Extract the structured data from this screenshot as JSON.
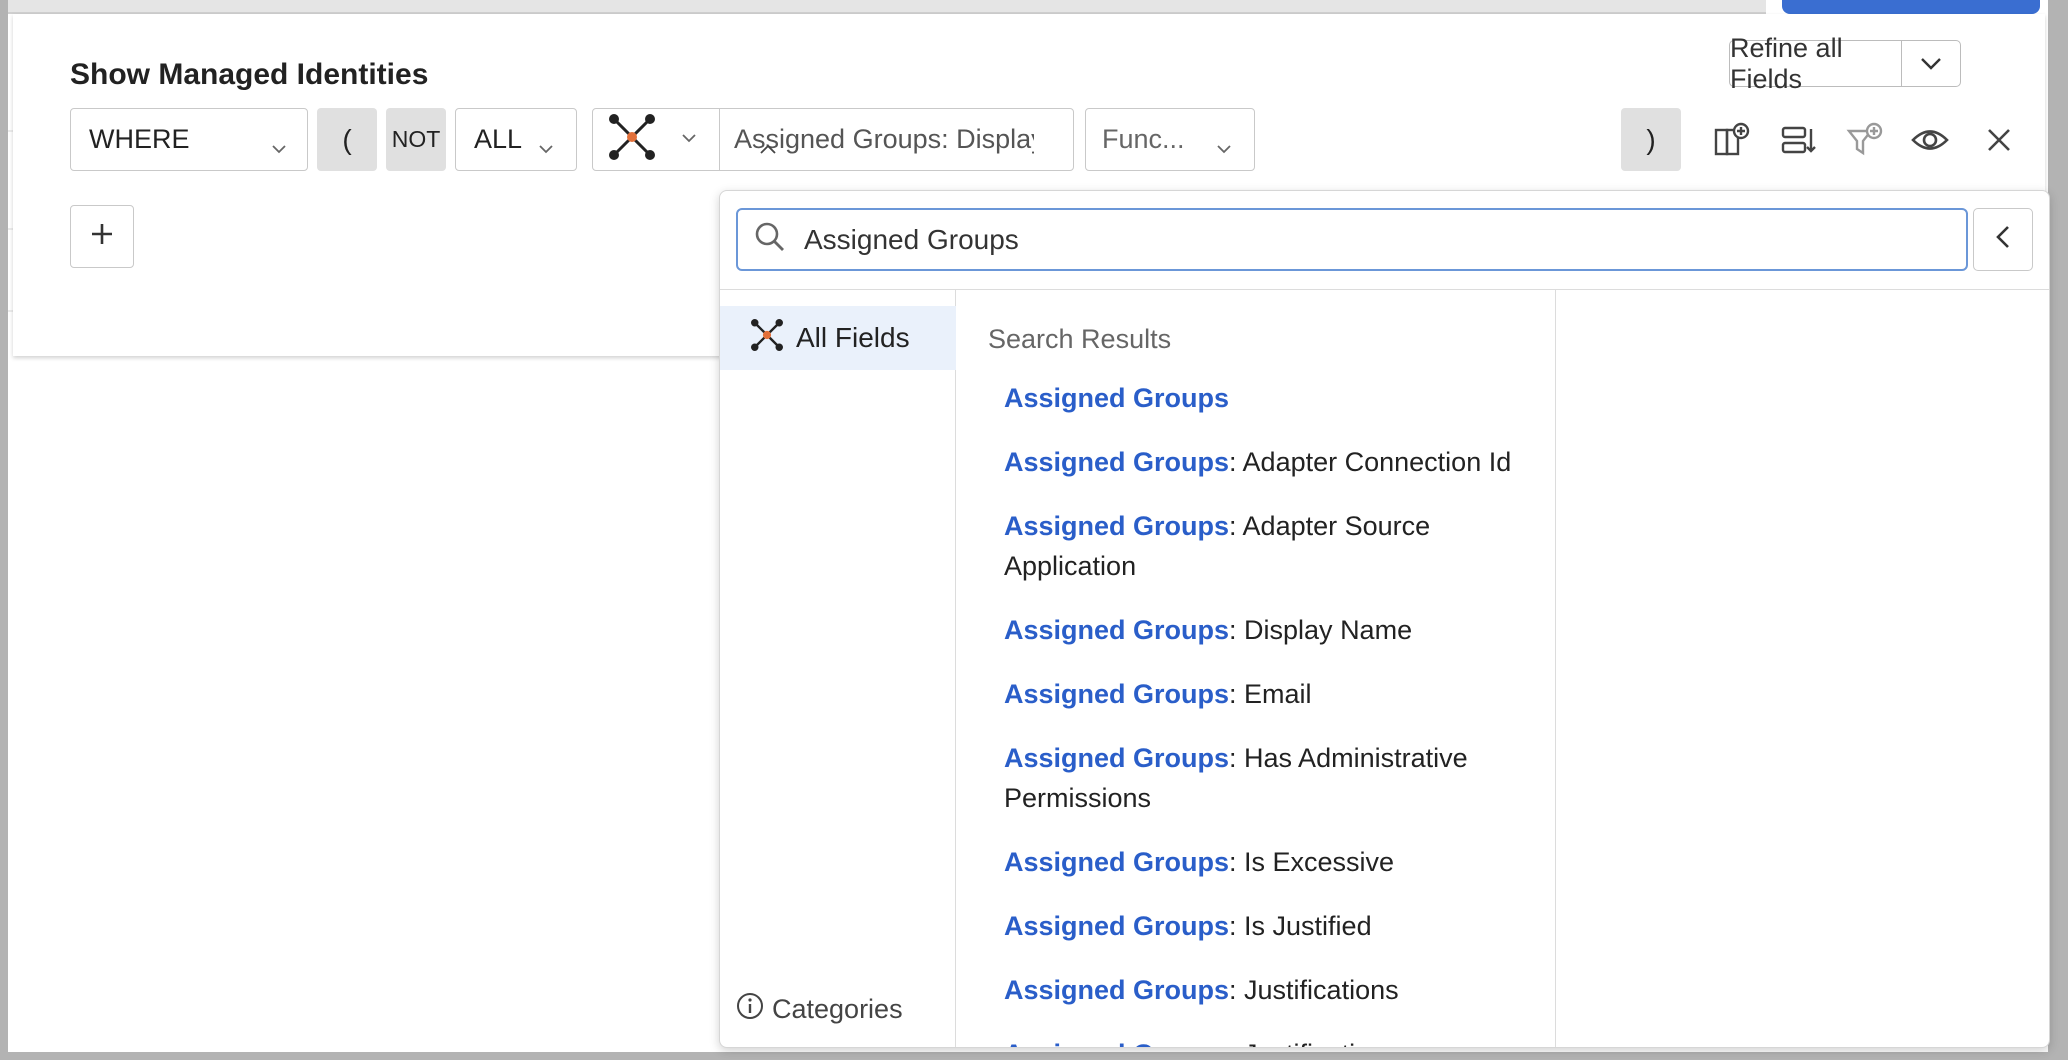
{
  "query": {
    "title": "Show Managed Identities",
    "refine_label": "Refine all Fields",
    "where_label": "WHERE",
    "paren_open": "(",
    "not_label": "NOT",
    "all_label": "ALL",
    "field_value": "Assigned Groups: Display Name",
    "function_placeholder": "Func...",
    "paren_close": ")"
  },
  "dropdown": {
    "search_value": "Assigned Groups",
    "all_fields_label": "All Fields",
    "results_heading": "Search Results",
    "categories_label": "Categories",
    "highlight": "Assigned Groups",
    "results": [
      {
        "suffix": ""
      },
      {
        "suffix": ": Adapter Connection Id"
      },
      {
        "suffix": ": Adapter Source Application"
      },
      {
        "suffix": ": Display Name"
      },
      {
        "suffix": ": Email"
      },
      {
        "suffix": ": Has Administrative Permissions"
      },
      {
        "suffix": ": Is Excessive"
      },
      {
        "suffix": ": Is Justified"
      },
      {
        "suffix": ": Justifications"
      },
      {
        "suffix": ": Justifications:"
      }
    ]
  },
  "colors": {
    "accent": "#2a5ec9",
    "selected_bg": "#eaf1fb",
    "focus_border": "#6b97d8",
    "node_orange": "#e2703a"
  },
  "icons": [
    "chevron-down-icon",
    "chevron-up-icon",
    "chevron-left-icon",
    "search-icon",
    "plus-icon",
    "column-add-icon",
    "sort-rows-icon",
    "filter-add-icon",
    "eye-icon",
    "close-icon",
    "network-nodes-icon",
    "info-icon"
  ]
}
